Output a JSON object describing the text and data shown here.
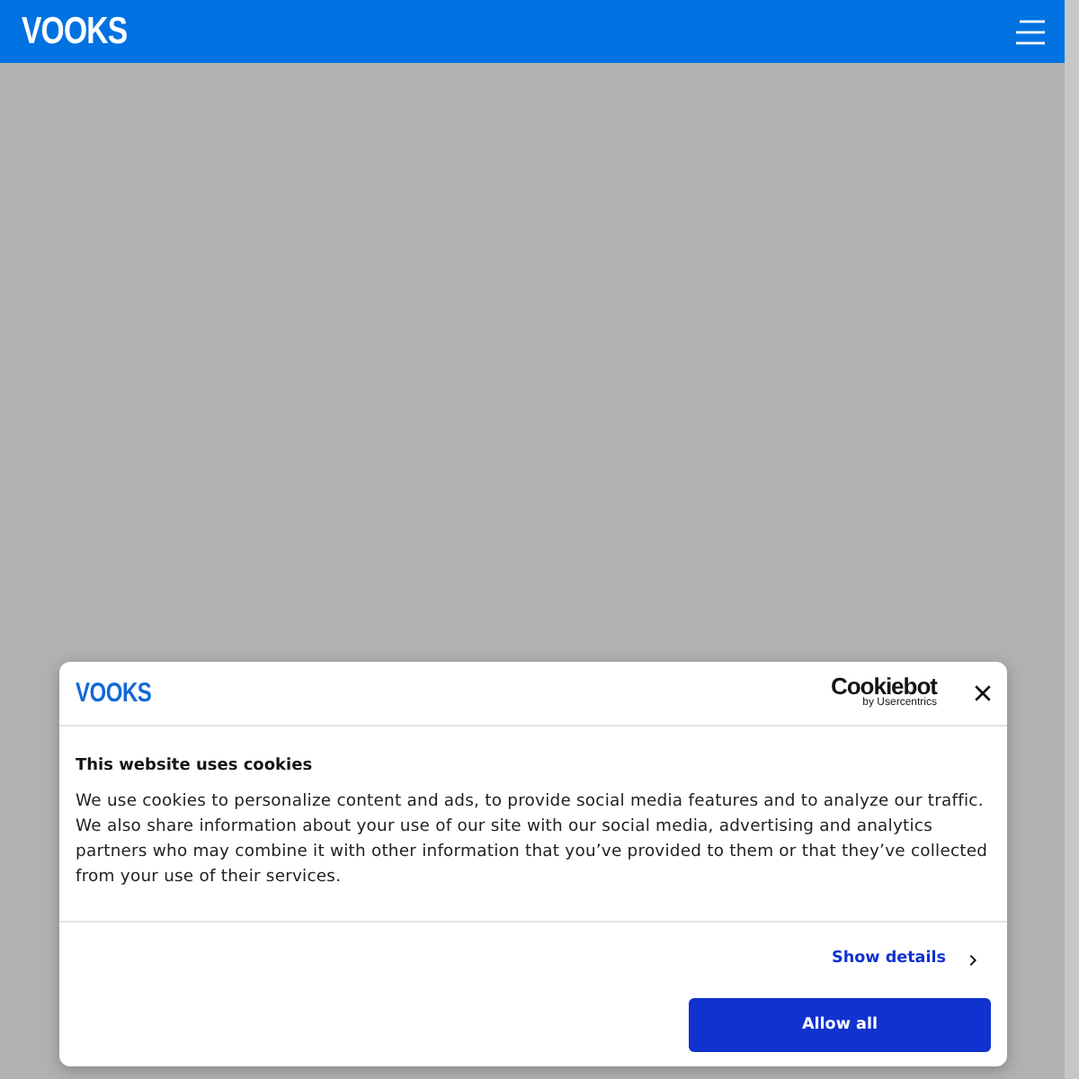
{
  "header": {
    "logo": "VOOKS"
  },
  "cookie_dialog": {
    "logo": "VOOKS",
    "provider_logo": {
      "name": "Cookiebot",
      "tagline": "by Usercentrics"
    },
    "title": "This website uses cookies",
    "body": "We use cookies to personalize content and ads, to provide social media features and to analyze our traffic. We also share information about your use of our site with our social media, advertising and analytics partners who may combine it with other information that you’ve provided to them or that they’ve collected from your use of their services.",
    "details_link": "Show details",
    "buttons": [
      "Allow all"
    ]
  }
}
